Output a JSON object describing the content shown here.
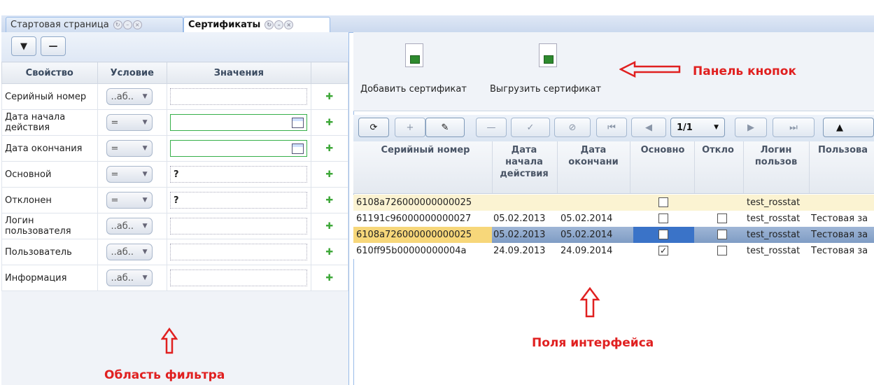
{
  "tabs": [
    {
      "label": "Стартовая страница"
    },
    {
      "label": "Сертификаты"
    }
  ],
  "filter": {
    "headers": {
      "property": "Свойство",
      "condition": "Условие",
      "values": "Значения"
    },
    "rows": [
      {
        "label": "Серийный номер",
        "condition": "..аб..",
        "value": "",
        "type": "text"
      },
      {
        "label": "Дата начала действия",
        "condition": "=",
        "value": "",
        "type": "date"
      },
      {
        "label": "Дата окончания",
        "condition": "=",
        "value": "",
        "type": "date"
      },
      {
        "label": "Основной",
        "condition": "=",
        "value": "?",
        "type": "bool"
      },
      {
        "label": "Отклонен",
        "condition": "=",
        "value": "?",
        "type": "bool"
      },
      {
        "label": "Логин пользователя",
        "condition": "..аб..",
        "value": "",
        "type": "text"
      },
      {
        "label": "Пользователь",
        "condition": "..аб..",
        "value": "",
        "type": "text"
      },
      {
        "label": "Информация",
        "condition": "..аб..",
        "value": "",
        "type": "text"
      }
    ]
  },
  "buttons": {
    "add_cert": "Добавить сертификат",
    "export_cert": "Выгрузить сертификат"
  },
  "pager": {
    "page": "1/1"
  },
  "grid": {
    "headers": [
      "Серийный номер",
      "Дата начала действия",
      "Дата окончани",
      "Основно",
      "Откло",
      "Логин пользов",
      "Пользова"
    ],
    "rows": [
      {
        "serial": "6108a726000000000025",
        "start": "",
        "end": "",
        "main": false,
        "rejected": null,
        "login": "test_rosstat",
        "user": ""
      },
      {
        "serial": "61191c96000000000027",
        "start": "05.02.2013",
        "end": "05.02.2014",
        "main": false,
        "rejected": false,
        "login": "test_rosstat",
        "user": "Тестовая за"
      },
      {
        "serial": "6108a726000000000025",
        "start": "05.02.2013",
        "end": "05.02.2014",
        "main": false,
        "rejected": false,
        "login": "test_rosstat",
        "user": "Тестовая за",
        "selected": true
      },
      {
        "serial": "610ff95b00000000004a",
        "start": "24.09.2013",
        "end": "24.09.2014",
        "main": true,
        "rejected": false,
        "login": "test_rosstat",
        "user": "Тестовая за"
      }
    ]
  },
  "annotations": {
    "button_panel": "Панель кнопок",
    "interface_fields": "Поля интерфейса",
    "filter_area": "Область фильтра"
  },
  "colors": {
    "annotation": "#e02020",
    "row_even": "#fbf3d2",
    "selected": "#3a73c8",
    "accent": "#99bbe8"
  }
}
